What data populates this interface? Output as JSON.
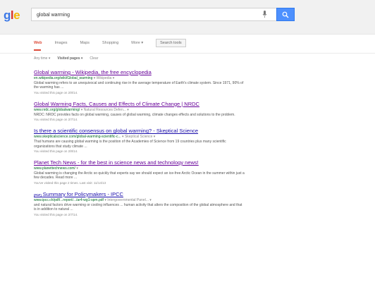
{
  "logo": {
    "text1": "g",
    "text2": "l",
    "text3": "e"
  },
  "search": {
    "query": "global warming"
  },
  "tabs": [
    "Web",
    "Images",
    "Maps",
    "Shopping",
    "More ▾",
    "Search tools"
  ],
  "filters": [
    "Any time ▾",
    "Visited pages ▾",
    "Clear"
  ],
  "results": [
    {
      "title": "Global warming - Wikipedia, the free encyclopedia",
      "url": "en.wikipedia.org/wiki/Global_warming",
      "url_extra": "▾  Wikipedia ▾",
      "snippet": "Global warming refers to an unequivocal and continuing rise in the average temperature of Earth's climate system. Since 1971, 90% of the warming has ...",
      "visited": "You visited this page on 2/8/14."
    },
    {
      "title": "Global Warming Facts, Causes and Effects of Climate Change | NRDC",
      "url": "www.nrdc.org/globalwarming/",
      "url_extra": "▾  Natural Resources Defen... ▾",
      "snippet": "NRDC: NRDC provides facts on global warming, causes of global warming, climate changes effects and solutions to the problem.",
      "visited": "You visited this page on 2/7/14."
    },
    {
      "title": "Is there a scientific consensus on global warming? - Skeptical Science",
      "url": "www.skepticalscience.com/global-warming-scientific-c...",
      "url_extra": "▾  Skeptical Science ▾",
      "snippet": "That humans are causing global warming is the position of the Academies of Science from 19 countries plus many scientific organizations that study climate ...",
      "visited": "You visited this page on 2/8/14."
    },
    {
      "title": "Planet Tech News - for the best in science news and technology news!",
      "url": "www.planettechnews.com/",
      "url_extra": "▾",
      "snippet": "Global warming is changing the Arctic so quickly that experts say we should expect an ice-free Arctic Ocean in the summer within just a few decades. Read more ...",
      "visited": "You've visited this page 2 times. Last visit: 11/14/13"
    },
    {
      "pdf": "[PDF]",
      "title": "Summary for Policymakers - IPCC",
      "url": "www.ipcc.ch/pdf/...report/.../ar4-wg1-spm.pdf",
      "url_extra": "▾  Intergovernmental Panel... ▾",
      "snippet": "and natural factors drive warming or cooling influences ... human activity that alters the composition of the global atmosphere and that is in addition to natural ...",
      "visited": "You visited this page on 2/7/14."
    }
  ]
}
